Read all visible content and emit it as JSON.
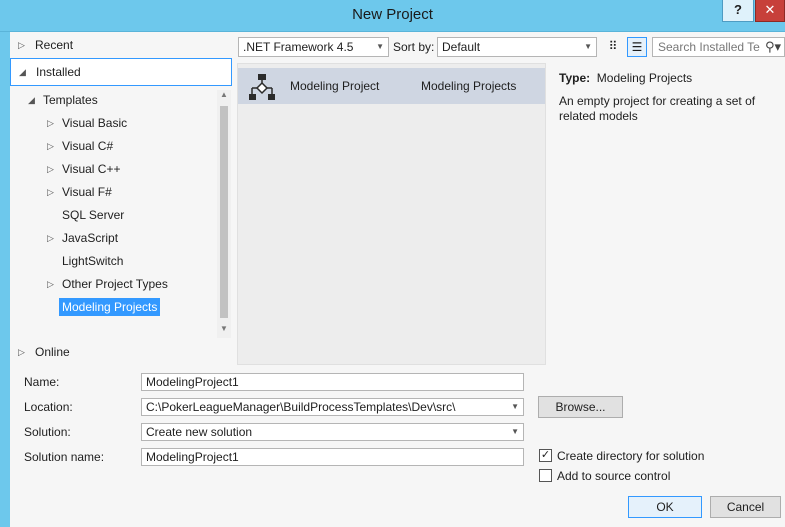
{
  "window": {
    "title": "New Project",
    "help_label": "?",
    "close_label": "X"
  },
  "nav": {
    "recent": "Recent",
    "installed": "Installed",
    "online": "Online",
    "tree": [
      {
        "label": "Templates",
        "expander": "◢",
        "level": 0
      },
      {
        "label": "Visual Basic",
        "expander": "▷",
        "level": 1
      },
      {
        "label": "Visual C#",
        "expander": "▷",
        "level": 1
      },
      {
        "label": "Visual C++",
        "expander": "▷",
        "level": 1
      },
      {
        "label": "Visual F#",
        "expander": "▷",
        "level": 1
      },
      {
        "label": "SQL Server",
        "expander": "",
        "level": 1
      },
      {
        "label": "JavaScript",
        "expander": "▷",
        "level": 1
      },
      {
        "label": "LightSwitch",
        "expander": "",
        "level": 1
      },
      {
        "label": "Other Project Types",
        "expander": "▷",
        "level": 1
      },
      {
        "label": "Modeling Projects",
        "expander": "",
        "level": 1,
        "selected": true
      }
    ]
  },
  "toolbar": {
    "framework": ".NET Framework 4.5",
    "sort_by_label": "Sort by:",
    "sort_by_value": "Default",
    "search_placeholder": "Search Installed Te"
  },
  "templates": [
    {
      "name": "Modeling Project",
      "category": "Modeling Projects"
    }
  ],
  "description": {
    "type_label": "Type:",
    "type_value": "Modeling Projects",
    "text": "An empty project for creating a set of related models"
  },
  "form": {
    "name_label": "Name:",
    "name_value": "ModelingProject1",
    "location_label": "Location:",
    "location_value": "C:\\PokerLeagueManager\\BuildProcessTemplates\\Dev\\src\\",
    "browse_label": "Browse...",
    "solution_label": "Solution:",
    "solution_value": "Create new solution",
    "solution_name_label": "Solution name:",
    "solution_name_value": "ModelingProject1",
    "create_dir_label": "Create directory for solution",
    "create_dir_checked": true,
    "source_control_label": "Add to source control",
    "source_control_checked": false,
    "ok_label": "OK",
    "cancel_label": "Cancel"
  }
}
